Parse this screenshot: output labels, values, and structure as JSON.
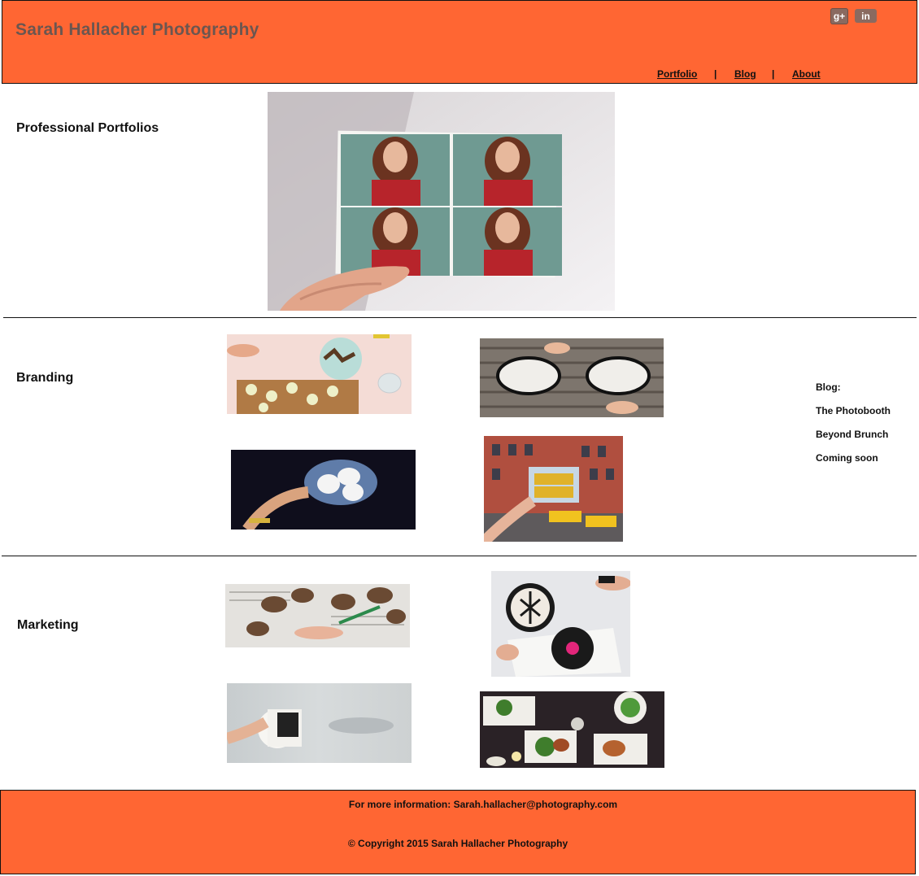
{
  "header": {
    "site_title": "Sarah Hallacher Photography",
    "social": {
      "gplus_label": "g+",
      "linkedin_label": "in"
    },
    "nav": [
      {
        "label": "Portfolio"
      },
      {
        "label": "Blog"
      },
      {
        "label": "About"
      }
    ],
    "nav_separator": "|"
  },
  "sections": {
    "portfolios": {
      "title": "Professional Portfolios"
    },
    "branding": {
      "title": "Branding"
    },
    "marketing": {
      "title": "Marketing"
    }
  },
  "blog": {
    "heading": "Blog:",
    "items": [
      "The Photobooth",
      "Beyond Brunch",
      "Coming soon"
    ]
  },
  "footer": {
    "contact": "For more information: Sarah.hallacher@photography.com",
    "copyright": "© Copyright 2015 Sarah Hallacher Photography"
  },
  "colors": {
    "brand": "#ff6633",
    "title_text": "#6b5650"
  }
}
